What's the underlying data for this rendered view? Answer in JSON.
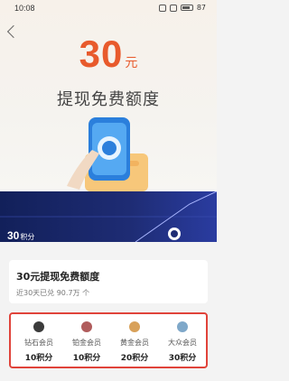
{
  "status": {
    "time": "10:08",
    "battery": "87"
  },
  "hero": {
    "amount": "30",
    "unit": "元",
    "subtitle": "提现免费额度"
  },
  "band": {
    "points": "30",
    "points_unit": "积分"
  },
  "card": {
    "title": "30元提现免费额度",
    "subtitle": "近30天已兑 90.7万 个"
  },
  "tiers": [
    {
      "name": "钻石会员",
      "points": "10积分",
      "icon": "diamond-icon",
      "color": "#3b3b3b"
    },
    {
      "name": "铂金会员",
      "points": "10积分",
      "icon": "platinum-icon",
      "color": "#b05c5c"
    },
    {
      "name": "黄金会员",
      "points": "20积分",
      "icon": "gold-icon",
      "color": "#d8a15a"
    },
    {
      "name": "大众会员",
      "points": "30积分",
      "icon": "public-icon",
      "color": "#7fa8c9"
    }
  ],
  "colors": {
    "accent": "#e85a2c",
    "band": "#12205a",
    "highlight_border": "#e0433a"
  }
}
